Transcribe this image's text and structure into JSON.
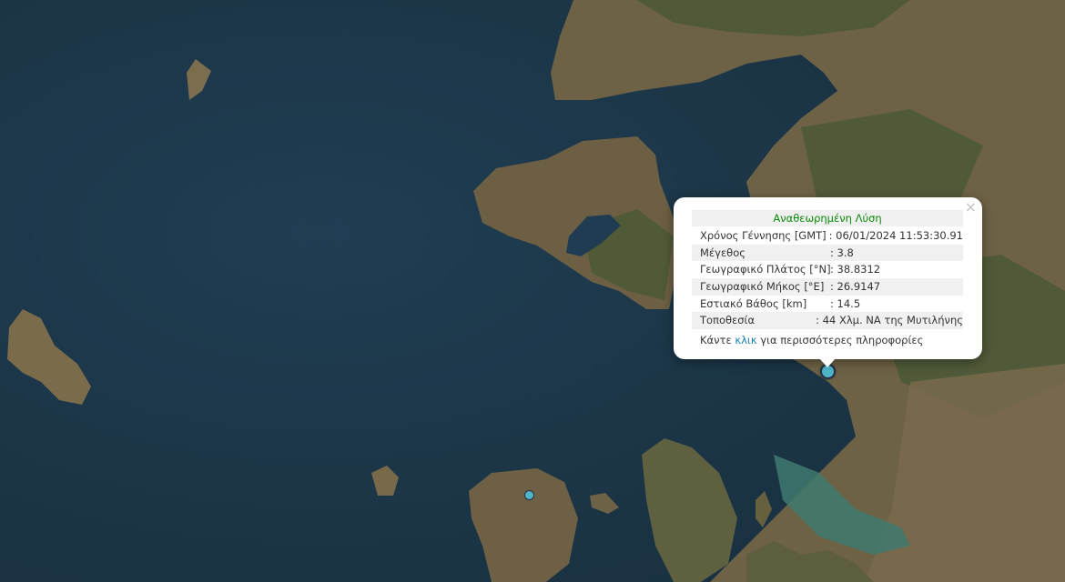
{
  "popup": {
    "title": "Αναθεωρημένη Λύση",
    "close_icon": "×",
    "rows": [
      {
        "label": "Χρόνος Γέννησης [GMT]",
        "value": ": 06/01/2024 11:53:30.91"
      },
      {
        "label": "Μέγεθος",
        "value": ": 3.8"
      },
      {
        "label": "Γεωγραφικό Πλάτος [°N]",
        "value": ": 38.8312"
      },
      {
        "label": "Γεωγραφικό Μήκος [°E]",
        "value": ": 26.9147"
      },
      {
        "label": "Εστιακό Βάθος [km]",
        "value": ": 14.5"
      },
      {
        "label": "Τοποθεσία",
        "value": ": 44 Χλμ. ΝΑ της Μυτιλήνης"
      }
    ],
    "footer_before": "Κάντε ",
    "footer_link": "κλικ",
    "footer_after": " για περισσότερες πληροφορίες"
  },
  "colors": {
    "sea": "#1e3a4f",
    "land": "#6f6144",
    "forest": "#4c5a36",
    "marker": "#4fb6c9",
    "title_green": "#0a8a0a",
    "link": "#1a7fb8"
  }
}
